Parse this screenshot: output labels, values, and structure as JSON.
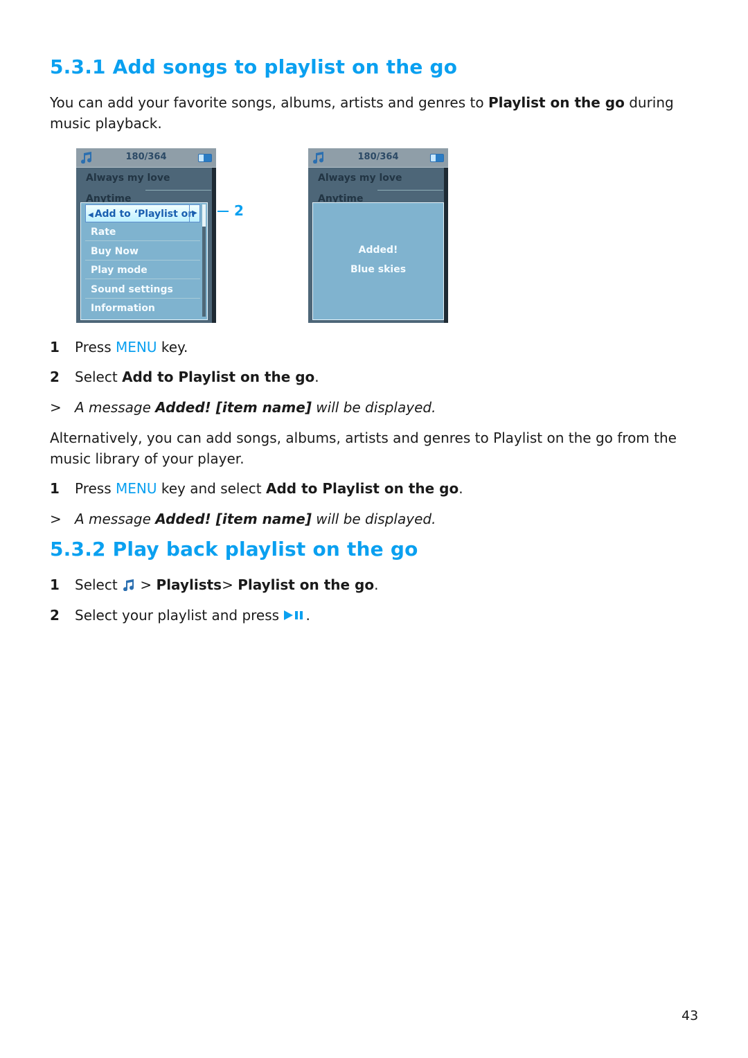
{
  "section1": {
    "heading": "5.3.1 Add songs to playlist on the go",
    "intro_pre": "You can add your favorite songs, albums, artists and genres to ",
    "intro_bold": "Playlist on the go",
    "intro_post": " during music playback.",
    "screen1": {
      "counter": "180/364",
      "rows": [
        "Always my love",
        "Anytime"
      ],
      "menu_items": [
        "Add to ‘Playlist on",
        "Rate",
        "Buy Now",
        "Play mode",
        "Sound settings",
        "Information"
      ],
      "selected_index": 0
    },
    "callout_number": "2",
    "screen2": {
      "counter": "180/364",
      "rows": [
        "Always my love",
        "Anytime"
      ],
      "message_title": "Added!",
      "message_item": "Blue skies"
    },
    "steps": [
      {
        "num": "1",
        "pre": "Press ",
        "menu": "MENU",
        "post": " key."
      },
      {
        "num": "2",
        "pre": "Select ",
        "bold": "Add to Playlist on the go",
        "post": "."
      }
    ],
    "result1": {
      "marker": ">",
      "pre": "A message ",
      "bold": "Added! [item name]",
      "post": " will be displayed."
    },
    "alt_text": "Alternatively, you can add songs, albums, artists and genres to Playlist on the go from the music library of your player.",
    "alt_step": {
      "num": "1",
      "pre": "Press ",
      "menu": "MENU",
      "mid": " key and select ",
      "bold": "Add to Playlist on the go",
      "post": "."
    },
    "result2": {
      "marker": ">",
      "pre": "A message ",
      "bold": "Added! [item name]",
      "post": " will be displayed."
    }
  },
  "section2": {
    "heading": "5.3.2 Play back playlist on the go",
    "step1": {
      "num": "1",
      "pre": "Select ",
      "icon": "music-note-icon",
      "mid": " > ",
      "bold1": "Playlists",
      "mid2": "> ",
      "bold2": "Playlist on the go",
      "post": "."
    },
    "step2": {
      "num": "2",
      "pre": "Select your playlist and press ",
      "icon": "play-pause-icon",
      "post": "."
    }
  },
  "page_number": "43",
  "colors": {
    "accent": "#0aa0f0",
    "text": "#1a1a1a"
  }
}
